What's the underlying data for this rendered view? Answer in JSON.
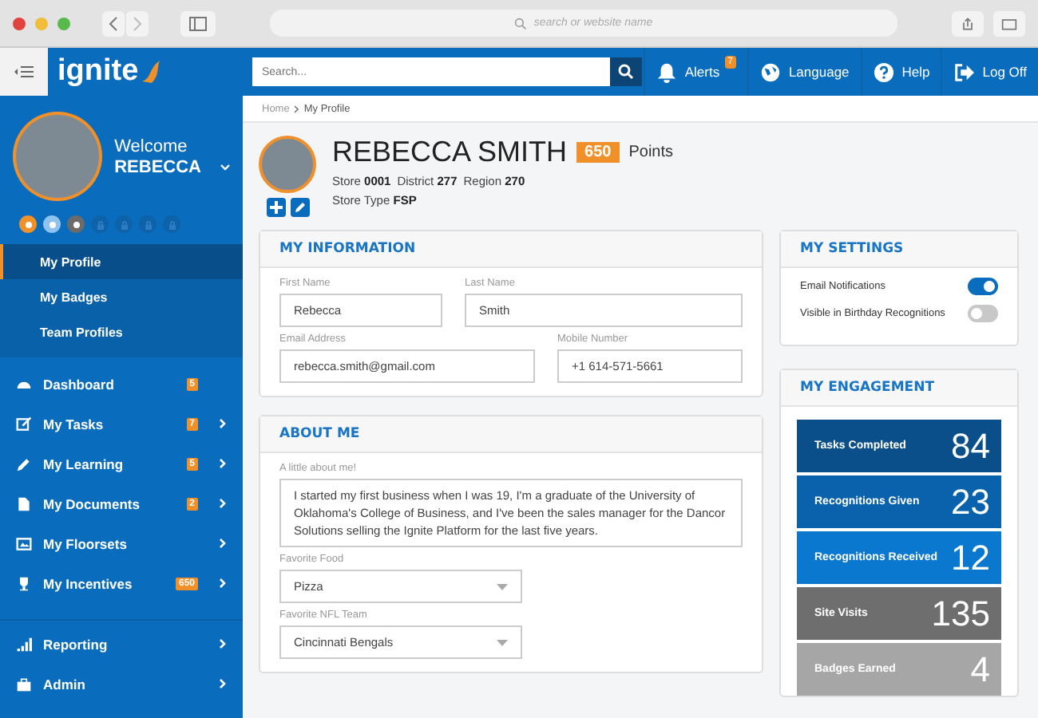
{
  "browser": {
    "address_placeholder": "search or website name"
  },
  "topbar": {
    "logo": "ignite",
    "search_placeholder": "Search...",
    "actions": [
      {
        "kind": "alerts",
        "label": "Alerts",
        "badge": "7"
      },
      {
        "kind": "language",
        "label": "Language"
      },
      {
        "kind": "help",
        "label": "Help"
      },
      {
        "kind": "logoff",
        "label": "Log Off"
      }
    ]
  },
  "sidebar": {
    "welcome": "Welcome",
    "name": "REBECCA",
    "badges": [
      {
        "locked": false,
        "color": "#f0902a"
      },
      {
        "locked": false,
        "color": "#8fc3ef"
      },
      {
        "locked": false,
        "color": "#6b6b6b"
      },
      {
        "locked": true,
        "color": "#0d62a8"
      },
      {
        "locked": true,
        "color": "#0d62a8"
      },
      {
        "locked": true,
        "color": "#0d62a8"
      },
      {
        "locked": true,
        "color": "#0d62a8"
      }
    ],
    "profile_menu": [
      {
        "label": "My Profile",
        "selected": true
      },
      {
        "label": "My Badges",
        "selected": false
      },
      {
        "label": "Team Profiles",
        "selected": false
      }
    ],
    "nav": [
      {
        "kind": "dashboard",
        "label": "Dashboard",
        "badge": "5",
        "expandable": false
      },
      {
        "kind": "tasks",
        "label": "My Tasks",
        "badge": "7",
        "expandable": true
      },
      {
        "kind": "learning",
        "label": "My Learning",
        "badge": "5",
        "expandable": true
      },
      {
        "kind": "documents",
        "label": "My Documents",
        "badge": "2",
        "expandable": true
      },
      {
        "kind": "floorsets",
        "label": "My Floorsets",
        "expandable": true
      },
      {
        "kind": "incentives",
        "label": "My Incentives",
        "badge": "650",
        "expandable": true
      }
    ],
    "nav_bottom": [
      {
        "kind": "reporting",
        "label": "Reporting",
        "expandable": true
      },
      {
        "kind": "admin",
        "label": "Admin",
        "expandable": true
      }
    ]
  },
  "breadcrumb": [
    "Home",
    "My Profile"
  ],
  "profile": {
    "name": "REBECCA SMITH",
    "points": "650",
    "points_label": "Points",
    "details": [
      [
        {
          "label": "Store",
          "value": "0001"
        },
        {
          "label": "District",
          "value": "277"
        },
        {
          "label": "Region",
          "value": "270"
        }
      ],
      [
        {
          "label": "Store Type",
          "value": "FSP"
        }
      ]
    ]
  },
  "my_information": {
    "title": "MY INFORMATION",
    "rows": [
      [
        {
          "label": "First Name",
          "value": "Rebecca"
        },
        {
          "label": "Last Name",
          "value": "Smith"
        }
      ],
      [
        {
          "label": "Email Address",
          "value": "rebecca.smith@gmail.com"
        },
        {
          "label": "Mobile Number",
          "value": "+1 614-571-5661"
        }
      ]
    ]
  },
  "about_me": {
    "title": "ABOUT ME",
    "bio_label": "A little about me!",
    "bio": "I started my first business when I was 19, I'm a graduate of the University of Oklahoma's College of Business, and I've been the sales manager for the Dancor Solutions selling the Ignite Platform for the last five years.",
    "selects": [
      {
        "label": "Favorite Food",
        "value": "Pizza"
      },
      {
        "label": "Favorite NFL Team",
        "value": "Cincinnati Bengals"
      }
    ]
  },
  "my_settings": {
    "title": "MY SETTINGS",
    "toggles": [
      {
        "label": "Email Notifications",
        "on": true
      },
      {
        "label": "Visible in Birthday Recognitions",
        "on": false
      }
    ]
  },
  "my_engagement": {
    "title": "MY ENGAGEMENT",
    "stats": [
      {
        "label": "Tasks Completed",
        "value": "84",
        "color": "#0b4f8a"
      },
      {
        "label": "Recognitions Given",
        "value": "23",
        "color": "#0a62ad"
      },
      {
        "label": "Recognitions Received",
        "value": "12",
        "color": "#0b78cf"
      },
      {
        "label": "Site Visits",
        "value": "135",
        "color": "#6e6e6e"
      },
      {
        "label": "Badges Earned",
        "value": "4",
        "color": "#a6a6a6"
      }
    ]
  }
}
